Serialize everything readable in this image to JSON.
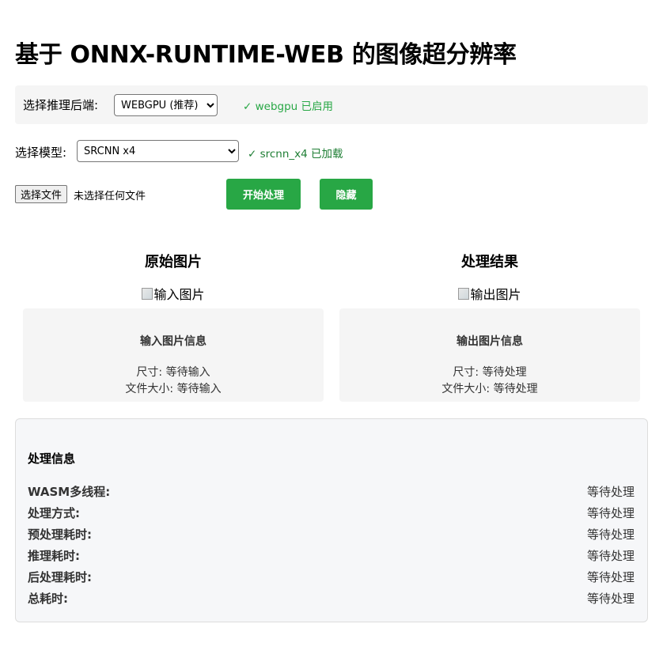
{
  "title": "基于 ONNX-RUNTIME-WEB 的图像超分辨率",
  "backend": {
    "label": "选择推理后端:",
    "selected": "WEBGPU (推荐)",
    "status": "✓ webgpu 已启用",
    "status_color": "#28a745"
  },
  "model": {
    "label": "选择模型:",
    "selected": "SRCNN x4",
    "status": "✓ srcnn_x4 已加载",
    "status_color": "#1e7e34"
  },
  "file": {
    "button_label": "选择文件",
    "status": "未选择任何文件"
  },
  "buttons": {
    "start": "开始处理",
    "hide": "隐藏",
    "accent": "#28a745"
  },
  "input_panel": {
    "title": "原始图片",
    "image_alt": "输入图片",
    "info_title": "输入图片信息",
    "size_line": "尺寸: 等待输入",
    "filesize_line": "文件大小: 等待输入"
  },
  "output_panel": {
    "title": "处理结果",
    "image_alt": "输出图片",
    "info_title": "输出图片信息",
    "size_line": "尺寸: 等待处理",
    "filesize_line": "文件大小: 等待处理"
  },
  "processing": {
    "title": "处理信息",
    "rows": [
      {
        "key": "WASM多线程:",
        "value": "等待处理"
      },
      {
        "key": "处理方式:",
        "value": "等待处理"
      },
      {
        "key": "预处理耗时:",
        "value": "等待处理"
      },
      {
        "key": "推理耗时:",
        "value": "等待处理"
      },
      {
        "key": "后处理耗时:",
        "value": "等待处理"
      },
      {
        "key": "总耗时:",
        "value": "等待处理"
      }
    ]
  }
}
